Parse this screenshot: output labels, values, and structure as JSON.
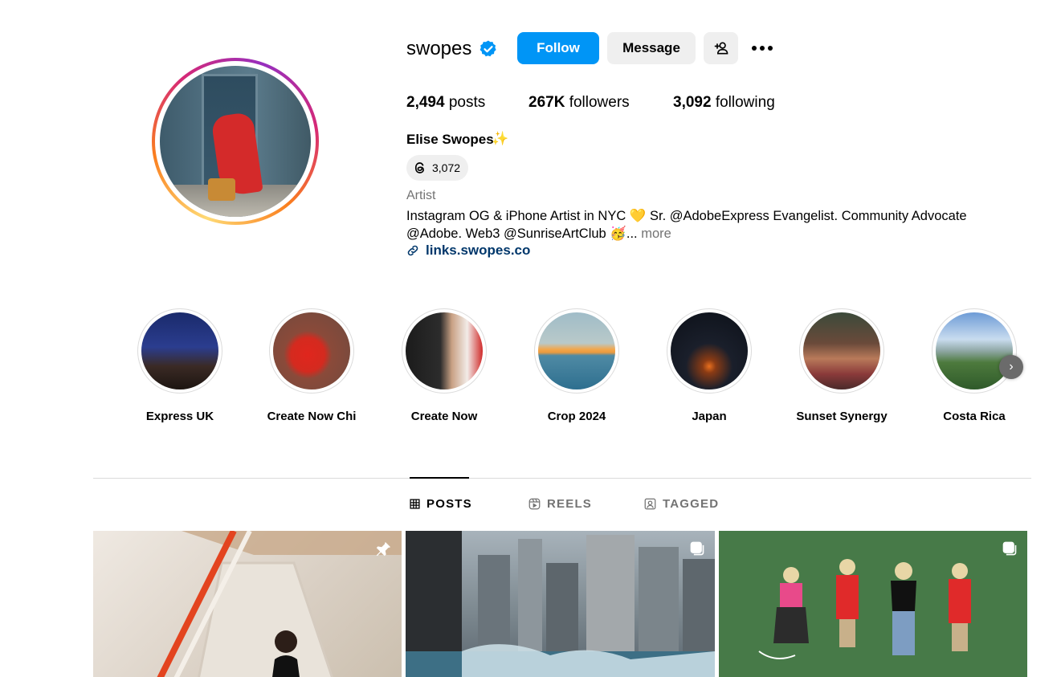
{
  "profile": {
    "username": "swopes",
    "full_name": "Elise Swopes",
    "threads_count": "3,072",
    "category": "Artist",
    "bio_line1": "Instagram OG & iPhone Artist in NYC 💛  Sr. @AdobeExpress Evangelist. Community Advocate",
    "bio_line2": "@Adobe. Web3 @SunriseArtClub 🥳...",
    "bio_more": "more",
    "link": "links.swopes.co"
  },
  "actions": {
    "follow": "Follow",
    "message": "Message"
  },
  "stats": {
    "posts_value": "2,494",
    "posts_label": "posts",
    "followers_value": "267K",
    "followers_label": "followers",
    "following_value": "3,092",
    "following_label": "following"
  },
  "highlights": [
    {
      "label": "Express UK"
    },
    {
      "label": "Create Now Chi"
    },
    {
      "label": "Create Now"
    },
    {
      "label": "Crop 2024"
    },
    {
      "label": "Japan"
    },
    {
      "label": "Sunset Synergy"
    },
    {
      "label": "Costa Rica"
    }
  ],
  "tabs": {
    "posts": "POSTS",
    "reels": "REELS",
    "tagged": "TAGGED"
  },
  "colors": {
    "primary_button": "#0095f6",
    "secondary_button": "#efefef",
    "link": "#00376b",
    "muted_text": "#737373"
  }
}
